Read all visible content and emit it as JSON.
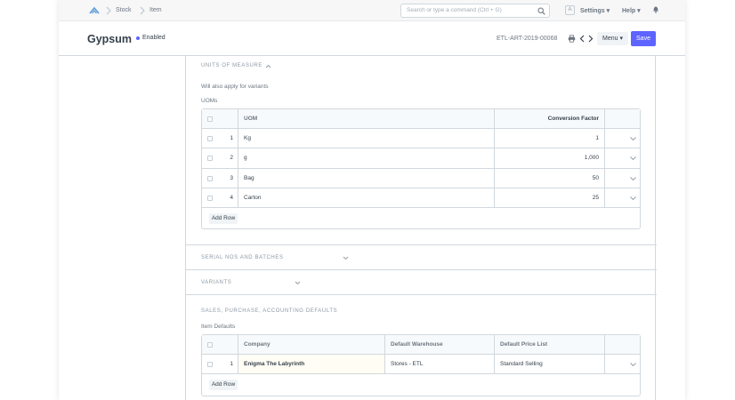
{
  "navbar": {
    "breadcrumbs": [
      "Stock",
      "Item"
    ],
    "search_placeholder": "Search or type a command (Ctrl + G)",
    "avatar_letter": "A",
    "settings_label": "Settings",
    "help_label": "Help"
  },
  "title_bar": {
    "title": "Gypsum",
    "status": "Enabled",
    "doc_name": "ETL-ART-2019-00068",
    "menu_label": "Menu",
    "save_label": "Save"
  },
  "uom_section": {
    "heading": "UNITS OF MEASURE",
    "note": "Will also apply for variants",
    "table_label": "UOMs",
    "columns": [
      "UOM",
      "Conversion Factor"
    ],
    "rows": [
      {
        "idx": "1",
        "uom": "Kg",
        "factor": "1"
      },
      {
        "idx": "2",
        "uom": "g",
        "factor": "1,000"
      },
      {
        "idx": "3",
        "uom": "Bag",
        "factor": "50"
      },
      {
        "idx": "4",
        "uom": "Carton",
        "factor": "25"
      }
    ],
    "add_row_label": "Add Row"
  },
  "serial_section": {
    "heading": "SERIAL NOS AND BATCHES"
  },
  "variants_section": {
    "heading": "VARIANTS"
  },
  "defaults_section": {
    "heading": "SALES, PURCHASE, ACCOUNTING DEFAULTS",
    "table_label": "Item Defaults",
    "columns": [
      "Company",
      "Default Warehouse",
      "Default Price List"
    ],
    "rows": [
      {
        "idx": "1",
        "company": "Enigma The Labyrinth",
        "warehouse": "Stores - ETL",
        "price_list": "Standard Selling"
      }
    ],
    "add_row_label": "Add Row"
  },
  "colors": {
    "accent": "#5e64ff",
    "border": "#d1d8dd",
    "muted": "#8d99a6"
  }
}
